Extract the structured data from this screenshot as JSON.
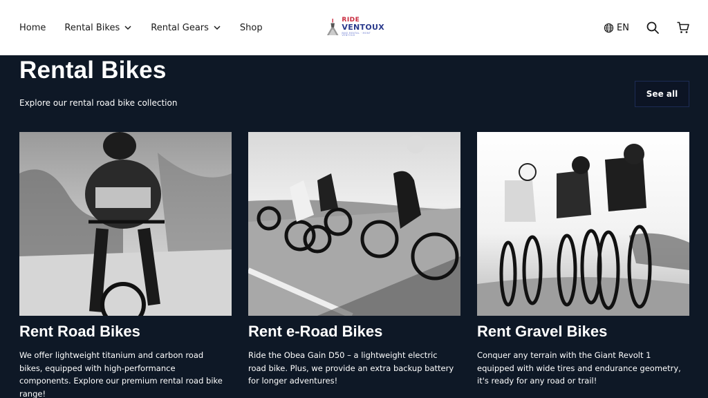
{
  "header": {
    "nav": [
      {
        "label": "Home",
        "has_dropdown": false
      },
      {
        "label": "Rental Bikes",
        "has_dropdown": true
      },
      {
        "label": "Rental Gears",
        "has_dropdown": true
      },
      {
        "label": "Shop",
        "has_dropdown": false
      }
    ],
    "logo": {
      "ride": "RIDE",
      "ventoux": "VENTOUX",
      "tagline": "BIKE RENTAL · MONT VENTOUX"
    },
    "language": "EN",
    "icons": [
      "globe-icon",
      "search-icon",
      "cart-icon"
    ]
  },
  "section": {
    "title": "Rental Bikes",
    "subtitle": "Explore our rental road bike collection",
    "see_all": "See all"
  },
  "cards": [
    {
      "title": "Rent Road Bikes",
      "description": "We offer lightweight titanium and carbon road bikes, equipped with high-performance components. Explore our premium rental road bike range!",
      "image": "cyclist-climbing-road-photo"
    },
    {
      "title": "Rent e-Road Bikes",
      "description": "Ride the Obea Gain D50 – a lightweight electric road bike. Plus, we provide an extra backup battery for longer adventures!",
      "image": "group-cyclists-road-photo"
    },
    {
      "title": "Rent Gravel Bikes",
      "description": "Conquer any terrain with the Giant Revolt 1 equipped with wide tires and endurance geometry, it's ready for any road or trail!",
      "image": "gravel-cyclists-photo"
    }
  ],
  "colors": {
    "background": "#0e1826",
    "header": "#ffffff",
    "logo_red": "#c8283c",
    "logo_blue": "#2a3a8c"
  }
}
